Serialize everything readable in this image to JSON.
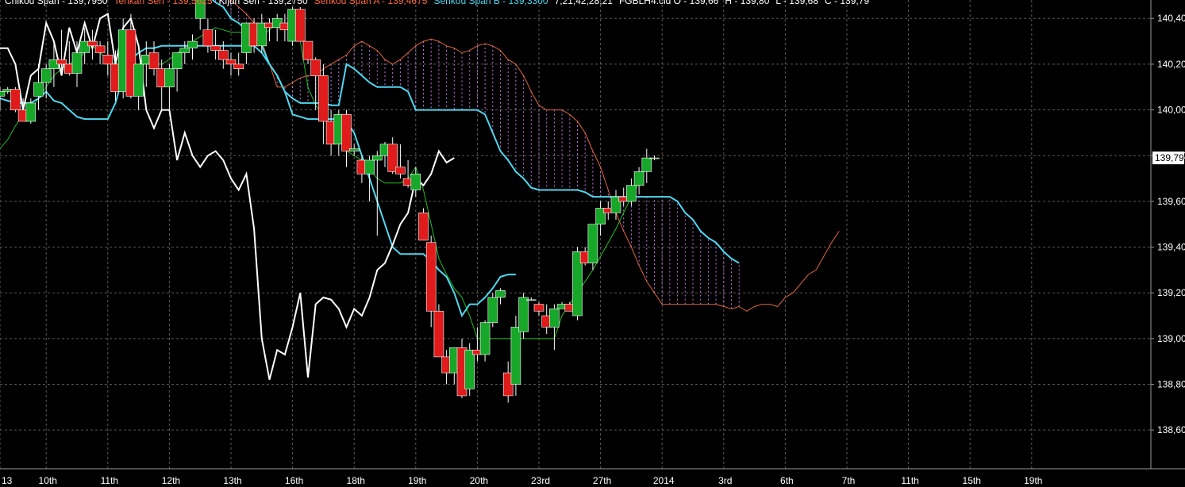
{
  "header": {
    "parts": [
      {
        "text": "Chikou Span - 139,7950",
        "color": "#ffffff"
      },
      {
        "text": "Tenkan Sen - 139,5625",
        "color": "#ff6a3d"
      },
      {
        "text": "Kijun Sen - 139,2750",
        "color": "#ffffff"
      },
      {
        "text": "Senkou Span A - 139,4675",
        "color": "#ff6a3d"
      },
      {
        "text": "Senkou Span B - 139,3300",
        "color": "#4fd8f0"
      },
      {
        "text": "7,21,42,28,21",
        "color": "#ffffff"
      },
      {
        "text": "FGBLH4.cid O - 139,66",
        "color": "#ffffff"
      },
      {
        "text": "H - 139,80",
        "color": "#ffffff"
      },
      {
        "text": "L - 139,68",
        "color": "#ffffff"
      },
      {
        "text": "C - 139,79",
        "color": "#ffffff"
      }
    ]
  },
  "colors": {
    "background": "#000000",
    "grid": "#5a5a5a",
    "bull": "#17a82a",
    "bear": "#e01b1b",
    "tenkan": "#20c020",
    "kijun": "#4fd8f0",
    "chikou": "#ffffff",
    "spanA": "#e0643c",
    "spanB": "#4fd8f0",
    "cloud": "#c27ae8"
  },
  "chart_data": {
    "type": "candlestick",
    "instrument": "FGBLH4.cid",
    "y_ticks": [
      "140,40",
      "140,20",
      "140,00",
      "139,80",
      "139,60",
      "139,40",
      "139,20",
      "139,00",
      "138,80",
      "138,60"
    ],
    "y_tick_values": [
      140.4,
      140.2,
      140.0,
      139.8,
      139.6,
      139.4,
      139.2,
      139.0,
      138.8,
      138.6
    ],
    "ylim": [
      138.5,
      140.55
    ],
    "x_labels": [
      "13",
      "10th",
      "11th",
      "12th",
      "13th",
      "16th",
      "18th",
      "19th",
      "20th",
      "23rd",
      "27th",
      "2014",
      "3rd",
      "6th",
      "7th",
      "11th",
      "15th",
      "19th"
    ],
    "x_label_index": [
      0,
      6,
      14,
      22,
      30,
      38,
      46,
      54,
      62,
      70,
      78,
      86,
      94,
      102,
      110,
      118,
      126,
      134
    ],
    "last_price": "139,79",
    "last_price_value": 139.79,
    "x_index_range": [
      0,
      148
    ],
    "candles_start_index": 0,
    "candles": [
      [
        140.06,
        140.1,
        140.0,
        140.08
      ],
      [
        140.08,
        140.1,
        140.07,
        140.09
      ],
      [
        140.09,
        140.1,
        139.99,
        140.0
      ],
      [
        140.0,
        140.05,
        139.95,
        139.95
      ],
      [
        139.95,
        140.05,
        139.94,
        140.03
      ],
      [
        140.06,
        140.2,
        140.0,
        140.12
      ],
      [
        140.12,
        140.2,
        140.05,
        140.18
      ],
      [
        140.18,
        140.3,
        140.1,
        140.22
      ],
      [
        140.22,
        140.35,
        140.15,
        140.2
      ],
      [
        140.2,
        140.3,
        140.15,
        140.16
      ],
      [
        140.16,
        140.3,
        140.1,
        140.25
      ],
      [
        140.25,
        140.36,
        140.2,
        140.3
      ],
      [
        140.3,
        140.35,
        140.22,
        140.28
      ],
      [
        140.28,
        140.3,
        140.2,
        140.25
      ],
      [
        140.24,
        140.3,
        140.15,
        140.2
      ],
      [
        140.2,
        140.26,
        140.04,
        140.08
      ],
      [
        140.08,
        140.4,
        140.05,
        140.35
      ],
      [
        140.35,
        140.42,
        140.05,
        140.06
      ],
      [
        140.06,
        140.2,
        140.0,
        140.2
      ],
      [
        140.2,
        140.3,
        140.1,
        140.24
      ],
      [
        140.25,
        140.3,
        140.15,
        140.18
      ],
      [
        140.18,
        140.22,
        140.0,
        140.1
      ],
      [
        140.1,
        140.2,
        140.0,
        140.18
      ],
      [
        140.18,
        140.25,
        140.08,
        140.25
      ],
      [
        140.25,
        140.3,
        140.2,
        140.27
      ],
      [
        140.27,
        140.33,
        140.22,
        140.3
      ],
      [
        140.4,
        140.55,
        140.35,
        140.55
      ],
      [
        140.35,
        140.4,
        140.25,
        140.28
      ],
      [
        140.28,
        140.35,
        140.22,
        140.26
      ],
      [
        140.26,
        140.3,
        140.18,
        140.22
      ],
      [
        140.22,
        140.25,
        140.15,
        140.2
      ],
      [
        140.2,
        140.25,
        140.15,
        140.18
      ],
      [
        140.25,
        140.38,
        140.2,
        140.38
      ],
      [
        140.38,
        140.4,
        140.25,
        140.28
      ],
      [
        140.28,
        140.42,
        140.25,
        140.38
      ],
      [
        140.38,
        140.4,
        140.3,
        140.36
      ],
      [
        140.36,
        140.42,
        140.3,
        140.4
      ],
      [
        140.38,
        140.42,
        140.3,
        140.35
      ],
      [
        140.3,
        140.45,
        140.28,
        140.44
      ],
      [
        140.44,
        140.45,
        140.3,
        140.3
      ],
      [
        140.3,
        140.3,
        140.2,
        140.22
      ],
      [
        140.22,
        140.23,
        140.0,
        140.15
      ],
      [
        140.15,
        140.2,
        139.85,
        139.95
      ],
      [
        139.95,
        140.0,
        139.8,
        139.85
      ],
      [
        139.85,
        140.0,
        139.8,
        139.98
      ],
      [
        139.98,
        140.0,
        139.75,
        139.82
      ],
      [
        139.82,
        139.85,
        139.8,
        139.83
      ],
      [
        139.78,
        139.8,
        139.68,
        139.72
      ],
      [
        139.72,
        139.8,
        139.6,
        139.78
      ],
      [
        139.78,
        139.82,
        139.45,
        139.8
      ],
      [
        139.8,
        139.86,
        139.75,
        139.85
      ],
      [
        139.85,
        139.88,
        139.72,
        139.73
      ],
      [
        139.75,
        139.85,
        139.7,
        139.72
      ],
      [
        139.7,
        139.78,
        139.66,
        139.67
      ],
      [
        139.65,
        139.75,
        139.62,
        139.72
      ],
      [
        139.55,
        139.57,
        139.45,
        139.43
      ],
      [
        139.42,
        139.45,
        139.05,
        139.12
      ],
      [
        139.12,
        139.15,
        138.92,
        138.92
      ],
      [
        138.92,
        138.95,
        138.8,
        138.85
      ],
      [
        138.85,
        138.96,
        138.8,
        138.96
      ],
      [
        138.96,
        139.0,
        138.74,
        138.75
      ],
      [
        138.78,
        138.98,
        138.75,
        138.95
      ],
      [
        138.95,
        139.05,
        138.9,
        138.93
      ],
      [
        138.93,
        139.08,
        138.9,
        139.07
      ],
      [
        139.07,
        139.2,
        139.05,
        139.18
      ],
      [
        139.18,
        139.22,
        139.15,
        139.21
      ],
      [
        138.85,
        138.9,
        138.72,
        138.75
      ],
      [
        138.8,
        139.1,
        138.75,
        139.05
      ],
      [
        139.03,
        139.2,
        139.0,
        139.18
      ],
      [
        139.17,
        139.18,
        139.17,
        139.17
      ],
      [
        139.15,
        139.16,
        139.1,
        139.12
      ],
      [
        139.1,
        139.15,
        139.02,
        139.05
      ],
      [
        139.05,
        139.15,
        138.95,
        139.13
      ],
      [
        139.13,
        139.16,
        139.13,
        139.15
      ],
      [
        139.15,
        139.16,
        139.12,
        139.12
      ],
      [
        139.1,
        139.4,
        139.08,
        139.38
      ],
      [
        139.38,
        139.4,
        139.32,
        139.33
      ],
      [
        139.33,
        139.5,
        139.3,
        139.5
      ],
      [
        139.5,
        139.6,
        139.45,
        139.57
      ],
      [
        139.57,
        139.6,
        139.52,
        139.55
      ],
      [
        139.55,
        139.65,
        139.52,
        139.62
      ],
      [
        139.62,
        139.66,
        139.58,
        139.6
      ],
      [
        139.6,
        139.7,
        139.58,
        139.67
      ],
      [
        139.67,
        139.75,
        139.63,
        139.73
      ],
      [
        139.73,
        139.83,
        139.68,
        139.79
      ],
      [
        139.79,
        139.8,
        139.78,
        139.79
      ]
    ],
    "series": [
      {
        "name": "Tenkan Sen",
        "start_index": 0,
        "values": [
          139.83,
          139.87,
          139.93,
          139.98,
          140.0,
          140.05,
          140.1,
          140.15,
          140.18,
          140.2,
          140.22,
          140.25,
          140.28,
          140.25,
          140.22,
          140.2,
          140.2,
          140.2,
          140.2,
          140.2,
          140.2,
          140.2,
          140.22,
          140.25,
          140.27,
          140.3,
          140.32,
          140.34,
          140.36,
          140.35,
          140.34,
          140.34,
          140.34,
          140.3,
          140.32,
          140.35,
          140.38,
          140.37,
          140.36,
          140.3,
          140.1,
          140.02,
          139.98,
          139.92,
          139.88,
          139.82,
          139.8,
          139.78,
          139.74,
          139.7,
          139.68,
          139.68,
          139.68,
          139.7,
          139.75,
          139.65,
          139.5,
          139.35,
          139.28,
          139.22,
          139.18,
          139.1,
          139.0,
          139.0,
          139.0,
          139.0,
          139.0,
          139.0,
          139.0,
          139.0,
          139.0,
          139.0,
          139.0,
          139.1,
          139.15,
          139.2,
          139.25,
          139.3,
          139.36,
          139.42,
          139.48,
          139.55,
          139.62,
          139.68
        ]
      },
      {
        "name": "Kijun Sen",
        "start_index": 0,
        "values": [
          140.05,
          140.04,
          140.03,
          140.03,
          140.03,
          140.05,
          140.08,
          140.04,
          140.03,
          140.0,
          139.97,
          139.96,
          139.96,
          139.96,
          139.96,
          140.03,
          140.15,
          140.22,
          140.25,
          140.27,
          140.27,
          140.28,
          140.28,
          140.28,
          140.28,
          140.28,
          140.28,
          140.28,
          140.28,
          140.28,
          140.28,
          140.28,
          140.28,
          140.28,
          140.25,
          140.2,
          140.15,
          140.08,
          139.98,
          139.97,
          139.96,
          139.96,
          139.96,
          139.96,
          139.96,
          139.95,
          139.9,
          139.8,
          139.7,
          139.6,
          139.5,
          139.4,
          139.37,
          139.37,
          139.37,
          139.37,
          139.34,
          139.3,
          139.27,
          139.2,
          139.1,
          139.15,
          139.15,
          139.18,
          139.22,
          139.27,
          139.28,
          139.28
        ]
      },
      {
        "name": "Chikou Span",
        "start_index": 0,
        "values": [
          140.27,
          140.27,
          140.2,
          140.0,
          140.15,
          140.18,
          140.38,
          140.3,
          140.15,
          140.36,
          140.25,
          140.38,
          140.27,
          140.4,
          140.42,
          140.2,
          140.36,
          140.4,
          140.28,
          140.0,
          139.92,
          140.0,
          140.0,
          139.78,
          139.9,
          139.8,
          139.75,
          139.8,
          139.82,
          139.78,
          139.7,
          139.65,
          139.72,
          139.48,
          139.0,
          138.82,
          138.95,
          138.93,
          139.05,
          139.2,
          138.83,
          139.15,
          139.18,
          139.17,
          139.13,
          139.05,
          139.13,
          139.1,
          139.18,
          139.3,
          139.33,
          139.41,
          139.5,
          139.55,
          139.7,
          139.67,
          139.72,
          139.82,
          139.77,
          139.79
        ]
      },
      {
        "name": "Senkou Span A",
        "start_index": 0,
        "values": [
          140.65,
          140.6,
          140.58,
          140.56,
          140.55,
          140.52,
          140.48,
          140.45,
          140.42,
          140.38,
          140.3,
          140.2,
          140.1,
          140.1,
          140.12,
          140.14,
          140.15,
          140.15,
          140.18,
          140.2,
          140.22,
          140.24,
          140.28,
          140.3,
          140.28,
          140.26,
          140.22,
          140.2,
          140.22,
          140.25,
          140.28,
          140.3,
          140.31,
          140.3,
          140.28,
          140.27,
          140.25,
          140.26,
          140.28,
          140.29,
          140.28,
          140.26,
          140.22,
          140.2,
          140.15,
          140.08,
          140.02,
          140.0,
          140.0,
          140.0,
          139.98,
          139.95,
          139.9,
          139.82,
          139.75,
          139.65,
          139.55,
          139.47,
          139.4,
          139.32,
          139.25,
          139.2,
          139.15,
          139.15,
          139.15,
          139.15,
          139.15,
          139.15,
          139.15,
          139.15,
          139.14,
          139.13,
          139.14,
          139.12,
          139.14,
          139.15,
          139.15,
          139.14,
          139.18,
          139.2,
          139.24,
          139.28,
          139.3,
          139.36,
          139.42,
          139.47
        ]
      },
      {
        "name": "Senkou Span B",
        "start_index": 0,
        "values": [
          140.55,
          140.55,
          140.52,
          140.5,
          140.47,
          140.45,
          140.4,
          140.38,
          140.35,
          140.32,
          140.28,
          140.2,
          140.15,
          140.08,
          140.05,
          140.03,
          140.03,
          140.03,
          140.03,
          140.02,
          140.02,
          140.2,
          140.18,
          140.15,
          140.12,
          140.1,
          140.1,
          140.1,
          140.1,
          140.08,
          140.0,
          140.0,
          140.0,
          140.0,
          140.0,
          140.0,
          140.0,
          140.0,
          140.0,
          139.98,
          139.9,
          139.82,
          139.78,
          139.73,
          139.7,
          139.66,
          139.65,
          139.65,
          139.65,
          139.65,
          139.65,
          139.65,
          139.64,
          139.62,
          139.62,
          139.62,
          139.62,
          139.62,
          139.62,
          139.62,
          139.62,
          139.62,
          139.62,
          139.62,
          139.6,
          139.55,
          139.52,
          139.47,
          139.44,
          139.42,
          139.38,
          139.35,
          139.33
        ]
      }
    ],
    "span_a_start_index": 24,
    "span_b_start_index": 24,
    "grid": true,
    "xlabel": "",
    "ylabel": "",
    "title": ""
  }
}
